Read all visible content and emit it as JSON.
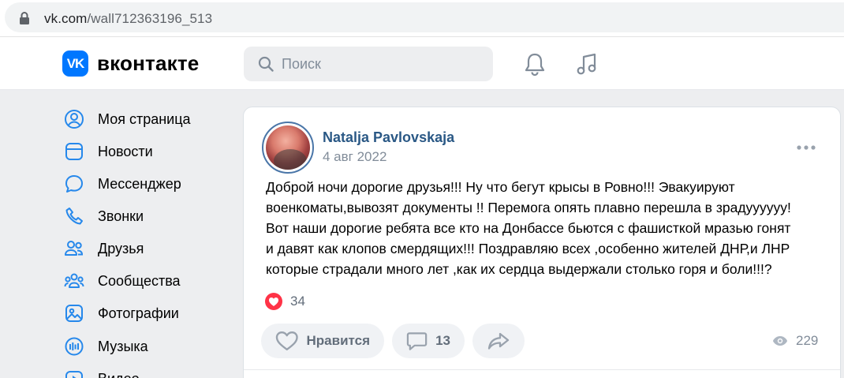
{
  "browser": {
    "url_host": "vk.com",
    "url_path": "/wall712363196_513"
  },
  "header": {
    "logo_mark": "VK",
    "logo_text": "вконтакте",
    "search_placeholder": "Поиск"
  },
  "sidebar": {
    "items": [
      {
        "label": "Моя страница",
        "icon": "user-circle-icon"
      },
      {
        "label": "Новости",
        "icon": "news-icon"
      },
      {
        "label": "Мессенджер",
        "icon": "message-icon"
      },
      {
        "label": "Звонки",
        "icon": "phone-icon"
      },
      {
        "label": "Друзья",
        "icon": "friends-icon"
      },
      {
        "label": "Сообщества",
        "icon": "communities-icon"
      },
      {
        "label": "Фотографии",
        "icon": "photo-icon"
      },
      {
        "label": "Музыка",
        "icon": "music-icon"
      },
      {
        "label": "Видео",
        "icon": "video-icon"
      }
    ]
  },
  "post": {
    "author": "Natalja Pavlovskaja",
    "date": "4 авг 2022",
    "text": "Доброй ночи дорогие друзья!!! Ну что бегут крысы в Ровно!!! Эвакуируют\nвоенкоматы,вывозят документы !! Перемога опять плавно перешла в зрадуууууу!\nВот наши дорогие ребята все кто на Донбассе бьются с фашисткой мразью гонят\nи давят как клопов смердящих!!! Поздравляю всех ,особенно жителей ДНР,и ЛНР\nкоторые страдали много лет ,как их сердца выдержали столько горя и боли!!!?",
    "reactions_count": "34",
    "like_label": "Нравится",
    "comments_count": "13",
    "views_count": "229"
  },
  "colors": {
    "accent": "#0077ff",
    "link": "#2a5885",
    "reaction": "#ff3347"
  }
}
